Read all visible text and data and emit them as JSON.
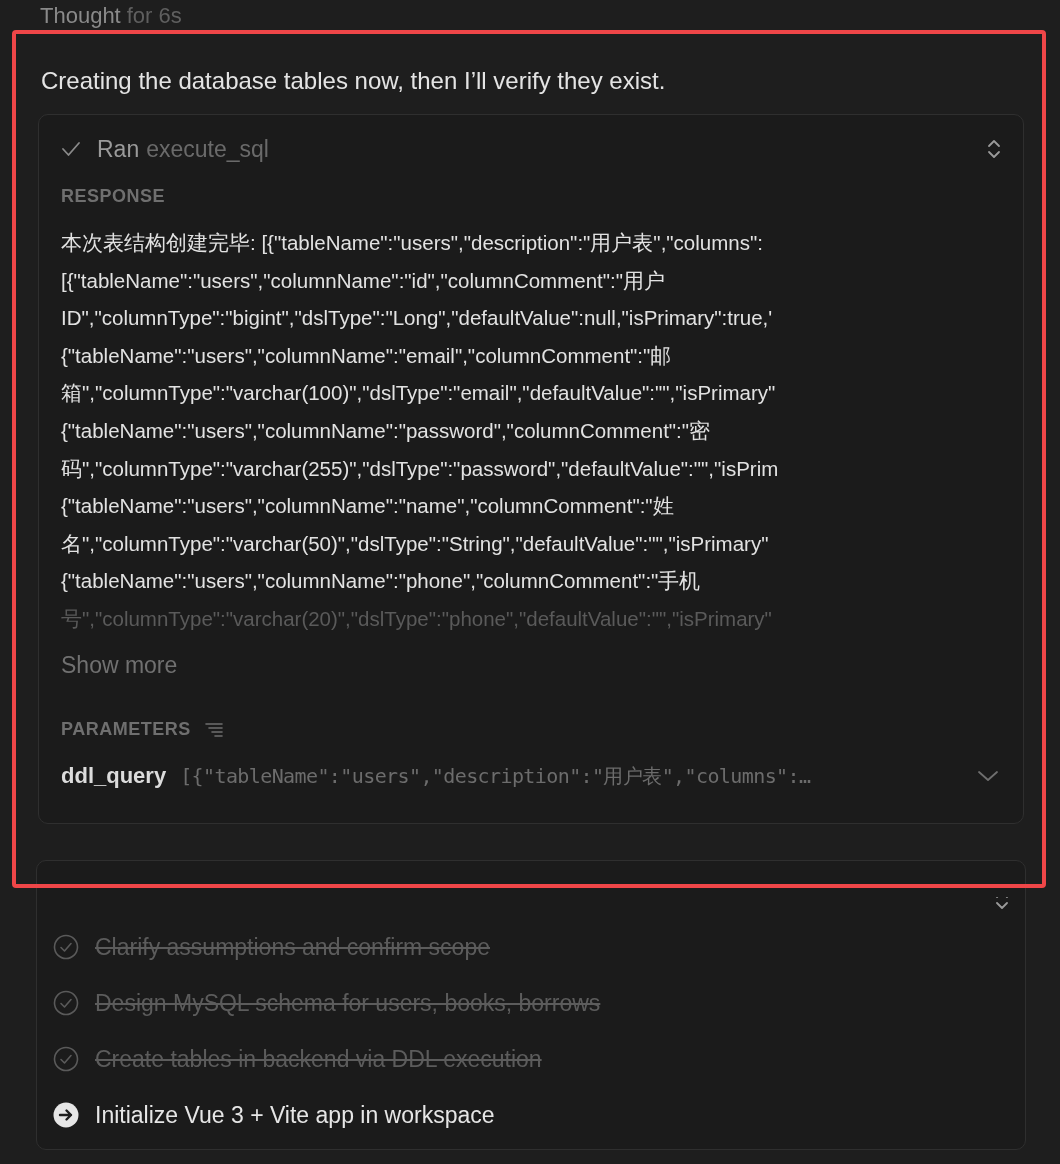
{
  "thought": {
    "label": "Thought",
    "duration": "for 6s"
  },
  "message": "Creating the database tables now, then I’ll verify they exist.",
  "tool_call": {
    "verb": "Ran",
    "tool": "execute_sql",
    "response_label": "RESPONSE",
    "response_lines": [
      "本次表结构创建完毕: [{\"tableName\":\"users\",\"description\":\"用户表\",\"columns\":",
      "[{\"tableName\":\"users\",\"columnName\":\"id\",\"columnComment\":\"用户",
      "ID\",\"columnType\":\"bigint\",\"dslType\":\"Long\",\"defaultValue\":null,\"isPrimary\":true,'",
      "{\"tableName\":\"users\",\"columnName\":\"email\",\"columnComment\":\"邮",
      "箱\",\"columnType\":\"varchar(100)\",\"dslType\":\"email\",\"defaultValue\":\"\",\"isPrimary\"",
      "{\"tableName\":\"users\",\"columnName\":\"password\",\"columnComment\":\"密",
      "码\",\"columnType\":\"varchar(255)\",\"dslType\":\"password\",\"defaultValue\":\"\",\"isPrim",
      "{\"tableName\":\"users\",\"columnName\":\"name\",\"columnComment\":\"姓",
      "名\",\"columnType\":\"varchar(50)\",\"dslType\":\"String\",\"defaultValue\":\"\",\"isPrimary\"",
      "{\"tableName\":\"users\",\"columnName\":\"phone\",\"columnComment\":\"手机",
      "号\",\"columnType\":\"varchar(20)\",\"dslType\":\"phone\",\"defaultValue\":\"\",\"isPrimary\""
    ],
    "show_more": "Show more",
    "parameters_label": "PARAMETERS",
    "parameters": [
      {
        "name": "ddl_query",
        "value": "[{\"tableName\":\"users\",\"description\":\"用户表\",\"columns\":…",
        "expanded": false
      }
    ]
  },
  "todos": {
    "items": [
      {
        "text": "Clarify assumptions and confirm scope",
        "kind": "done"
      },
      {
        "text": "Design MySQL schema for users, books, borrows",
        "kind": "done"
      },
      {
        "text": "Create tables in backend via DDL execution",
        "kind": "done"
      },
      {
        "text": "Initialize Vue 3 + Vite app in workspace",
        "kind": "current"
      }
    ]
  }
}
